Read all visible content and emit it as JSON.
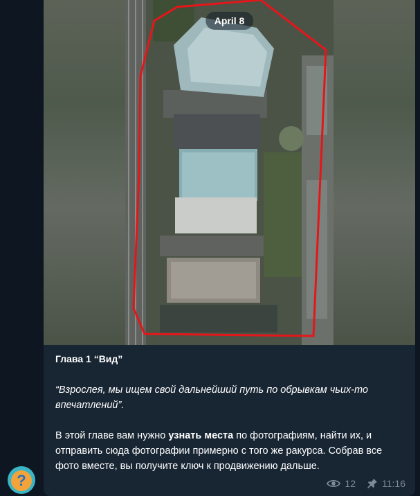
{
  "message": {
    "date_label": "April 8",
    "title": "Глава 1 “Вид”",
    "quote": "“Взрослея, мы ищем свой дальнейший путь по обрывкам чьих-то впечатлений”.",
    "body_before": "В этой главе вам нужно ",
    "body_bold": "узнать места",
    "body_after": " по фотографиям, найти их, и отправить сюда фотографии примерно с того же ракурса. Собрав все фото вместе, вы получите ключ к продвижению дальше.",
    "views": "12",
    "time": "11:16"
  },
  "avatar": {
    "glyph": "?"
  },
  "icons": {
    "views": "eye-icon",
    "pinned": "pin-icon",
    "avatar": "question-mark-avatar"
  },
  "colors": {
    "background": "#0e1621",
    "bubble": "#182533",
    "meta": "#7d8b99",
    "outline": "#e5161a"
  }
}
